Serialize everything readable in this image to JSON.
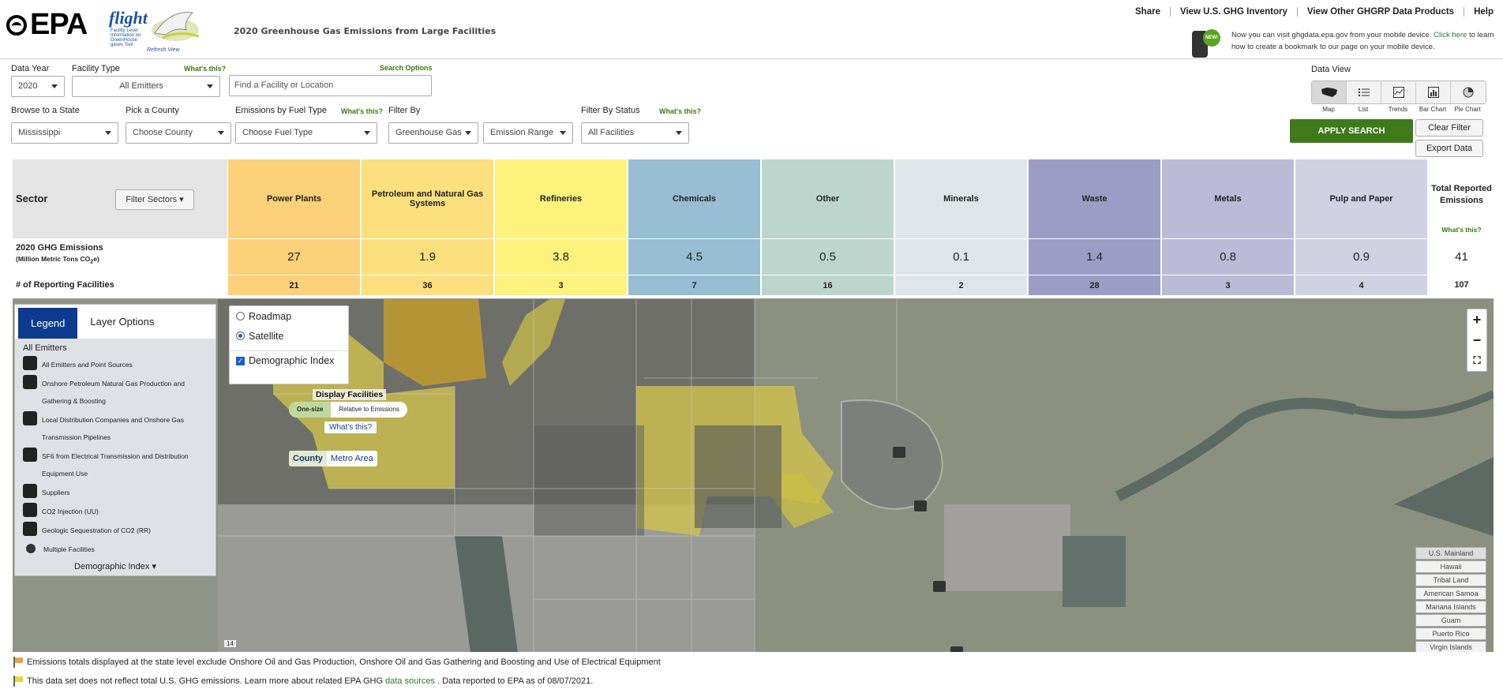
{
  "header": {
    "logo_text": "EPA",
    "flight_text": "flight",
    "flight_subtitle": "Facility Level Information on GreenHouse gases Tool",
    "refresh_view": "Refresh View",
    "page_title": "2020 Greenhouse Gas Emissions from Large Facilities",
    "top_links": [
      "Share",
      "View U.S. GHG Inventory",
      "View Other GHGRP Data Products",
      "Help"
    ],
    "new_badge": "NEW!",
    "mobile_note_pre": "Now you can visit ghgdata.epa.gov from your mobile device.",
    "mobile_note_link": "Click here",
    "mobile_note_post": "to learn how to create a bookmark to our page on your mobile device."
  },
  "filters": {
    "data_year_label": "Data Year",
    "data_year_value": "2020",
    "facility_type_label": "Facility Type",
    "facility_type_value": "All Emitters",
    "whats_this": "What's this?",
    "search_placeholder": "Find a Facility or Location",
    "search_options": "Search Options",
    "state_label": "Browse to a State",
    "state_value": "Mississippi",
    "county_label": "Pick a County",
    "county_value": "Choose County",
    "fuel_label": "Emissions by Fuel Type",
    "fuel_value": "Choose Fuel Type",
    "filter_by_label": "Filter By",
    "ghg_value": "Greenhouse Gas",
    "range_value": "Emission Range",
    "status_label": "Filter By Status",
    "status_value": "All Facilities"
  },
  "data_view": {
    "label": "Data View",
    "options": [
      "Map",
      "List",
      "Trends",
      "Bar Chart",
      "Pie Chart"
    ],
    "icons": [
      "map-icon",
      "list-icon",
      "trends-icon",
      "bar-chart-icon",
      "pie-chart-icon"
    ],
    "apply_label": "APPLY SEARCH",
    "clear_label": "Clear Filter",
    "export_label": "Export Data"
  },
  "sectors": {
    "title": "Sector",
    "filter_label": "Filter Sectors",
    "emissions_label": "2020 GHG Emissions",
    "emissions_unit": "(Million Metric Tons CO",
    "emissions_unit_sub": "2",
    "emissions_unit_end": "e)",
    "facilities_label": "# of Reporting Facilities",
    "items": [
      {
        "name": "Power Plants",
        "emissions": "27",
        "facilities": "21",
        "color": "#fdd07a"
      },
      {
        "name": "Petroleum and Natural Gas Systems",
        "emissions": "1.9",
        "facilities": "36",
        "color": "#fbe07d"
      },
      {
        "name": "Refineries",
        "emissions": "3.8",
        "facilities": "3",
        "color": "#fdf37c"
      },
      {
        "name": "Chemicals",
        "emissions": "4.5",
        "facilities": "7",
        "color": "#97bed2"
      },
      {
        "name": "Other",
        "emissions": "0.5",
        "facilities": "16",
        "color": "#bdd6cd"
      },
      {
        "name": "Minerals",
        "emissions": "0.1",
        "facilities": "2",
        "color": "#dfe6ea"
      },
      {
        "name": "Waste",
        "emissions": "1.4",
        "facilities": "28",
        "color": "#9c9dc4"
      },
      {
        "name": "Metals",
        "emissions": "0.8",
        "facilities": "3",
        "color": "#bbbbd8"
      },
      {
        "name": "Pulp and Paper",
        "emissions": "0.9",
        "facilities": "4",
        "color": "#d0d2e4"
      }
    ],
    "total_label": "Total Reported Emissions",
    "total_whats": "What's this?",
    "total_emissions": "41",
    "total_facilities": "107"
  },
  "map": {
    "legend_tab": "Legend",
    "layer_tab": "Layer Options",
    "legend_title": "All Emitters",
    "legend_items": [
      {
        "label": "All Emitters and Point Sources",
        "icon": "all-emitters-icon"
      },
      {
        "label": "Onshore Petroleum Natural Gas Production and Gathering & Boosting",
        "icon": "onshore-petroleum-icon"
      },
      {
        "label": "Local Distribution Companies and Onshore Gas Transmission Pipelines",
        "icon": "local-distribution-icon"
      },
      {
        "label": "SF6 from Electrical Transmission and Distribution Equipment Use",
        "icon": "sf6-icon"
      },
      {
        "label": "Suppliers",
        "icon": "suppliers-icon"
      },
      {
        "label": "CO2 Injection (UU)",
        "icon": "co2-injection-icon"
      },
      {
        "label": "Geologic Sequestration of CO2 (RR)",
        "icon": "geologic-sequestration-icon"
      },
      {
        "label": "Multiple Facilities",
        "icon": "multiple-facilities-icon"
      }
    ],
    "demographic_index": "Demographic Index",
    "roadmap": "Roadmap",
    "satellite": "Satellite",
    "demographic_checkbox": "Demographic Index",
    "display_facilities": "Display Facilities",
    "one_size": "One-size",
    "relative": "Relative to Emissions",
    "whats_this": "What's this?",
    "county": "County",
    "metro": "Metro Area",
    "zoom_in": "+",
    "zoom_out": "−",
    "fullscreen": "⛶",
    "regions": [
      "U.S. Mainland",
      "Hawaii",
      "Tribal Land",
      "American Samoa",
      "Mariana Islands",
      "Guam",
      "Puerto Rico",
      "Virgin Islands"
    ],
    "scale": "14"
  },
  "notes": {
    "note1": "Emissions totals displayed at the state level exclude Onshore Oil and Gas Production, Onshore Oil and Gas Gathering and Boosting and Use of Electrical Equipment",
    "note2_pre": "This data set does not reflect total U.S. GHG emissions. Learn more about related EPA GHG",
    "note2_link": "data sources",
    "note2_post": ". Data reported to EPA as of 08/07/2021."
  }
}
